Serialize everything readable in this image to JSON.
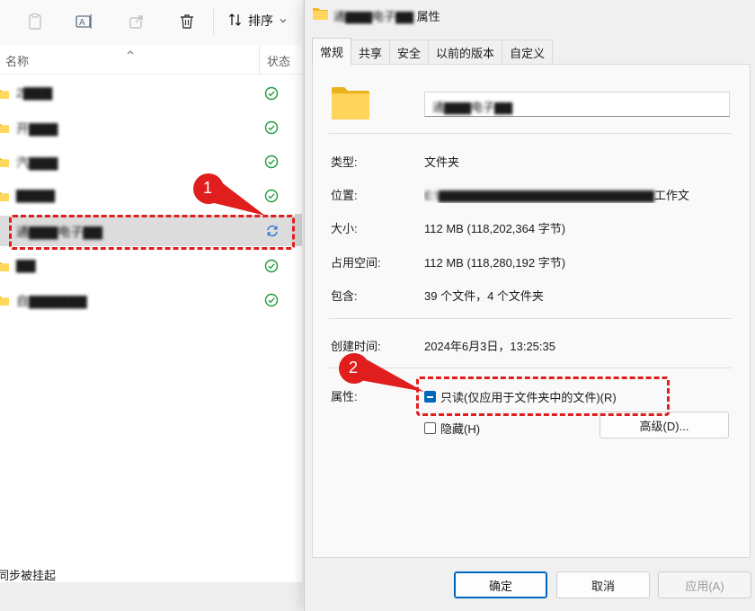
{
  "explorer": {
    "toolbar": {
      "sort_label": "排序",
      "icons": [
        "paste-icon",
        "rename-icon",
        "share-icon",
        "delete-icon",
        "sort-icon",
        "chevron-down-icon"
      ]
    },
    "columns": {
      "name": "名称",
      "status": "状态"
    },
    "files": [
      {
        "name": "2▇▇▇",
        "status": "synced"
      },
      {
        "name": "开▇▇▇",
        "status": "synced"
      },
      {
        "name": "汽▇▇▇",
        "status": "synced"
      },
      {
        "name": "▇▇▇▇",
        "status": "synced"
      },
      {
        "name": "通▇▇▇电子▇▇",
        "status": "syncing"
      },
      {
        "name": "▇▇",
        "status": "synced"
      },
      {
        "name": "自▇▇▇▇▇▇",
        "status": "synced"
      }
    ],
    "status_text": "同步被挂起"
  },
  "dialog": {
    "title_blur": "通▇▇▇电子▇▇",
    "title_suffix": " 属性",
    "tabs": [
      "常规",
      "共享",
      "安全",
      "以前的版本",
      "自定义"
    ],
    "active_tab": 0,
    "folder_name": "通▇▇▇电子▇▇",
    "props": {
      "type_label": "类型:",
      "type_value": "文件夹",
      "location_label": "位置:",
      "location_blur": "E:\\▇▇▇▇▇▇▇▇▇▇▇▇▇▇▇▇▇▇▇▇▇▇▇▇",
      "location_tail": "工作文",
      "size_label": "大小:",
      "size_value": "112 MB (118,202,364 字节)",
      "disk_label": "占用空间:",
      "disk_value": "112 MB (118,280,192 字节)",
      "contains_label": "包含:",
      "contains_value": "39 个文件，4 个文件夹",
      "created_label": "创建时间:",
      "created_value": "2024年6月3日，13:25:35",
      "attributes_label": "属性:"
    },
    "attributes": {
      "readonly_label": "只读(仅应用于文件夹中的文件)(R)",
      "readonly_state": "indeterminate",
      "hidden_label": "隐藏(H)",
      "hidden_checked": false,
      "advanced_label": "高级(D)..."
    },
    "buttons": {
      "ok": "确定",
      "cancel": "取消",
      "apply": "应用(A)"
    }
  },
  "annotations": {
    "marker_1": "1",
    "marker_2": "2",
    "accent_color": "#e01e1e"
  }
}
